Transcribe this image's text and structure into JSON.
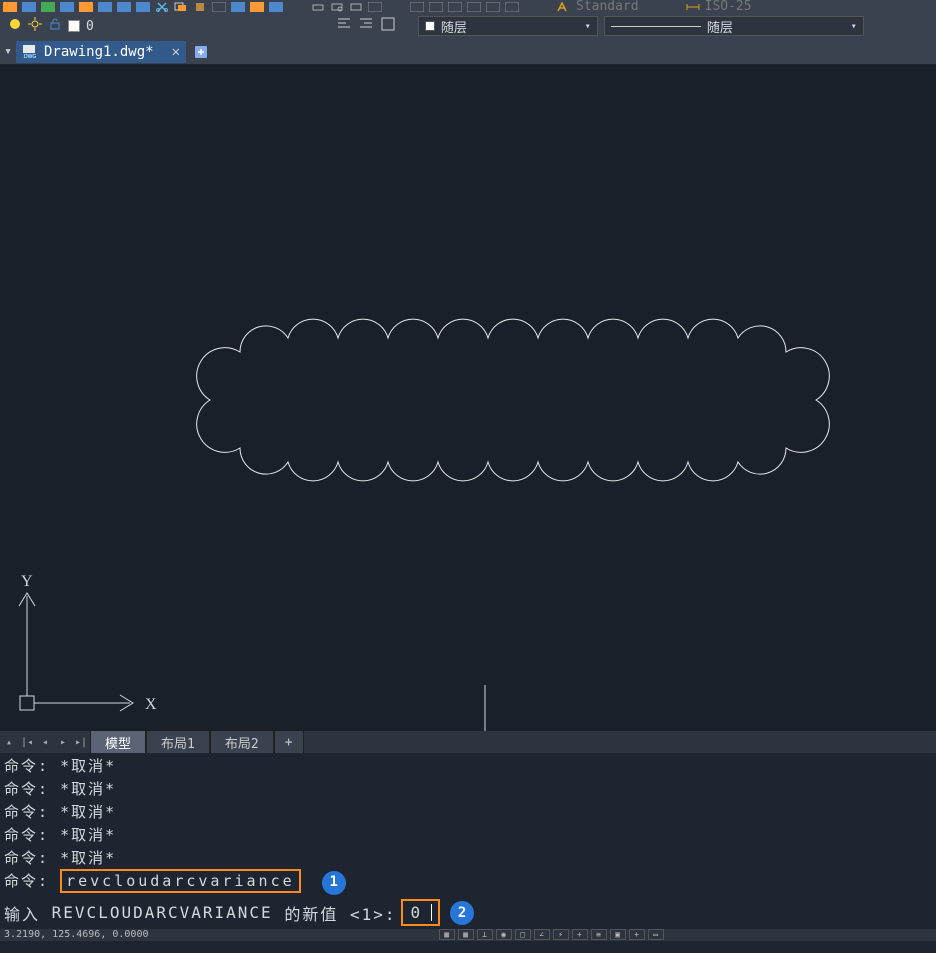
{
  "top_style_dropdown_1": "Standard",
  "top_style_dropdown_2": "ISO-25",
  "layer_current": "0",
  "bylayer_label_1": "随层",
  "bylayer_label_2": "随层",
  "file_tab": {
    "name": "Drawing1.dwg*"
  },
  "layout_tabs": {
    "model": "模型",
    "layout1": "布局1",
    "layout2": "布局2",
    "plus": "+"
  },
  "ucs": {
    "x": "X",
    "y": "Y"
  },
  "command_history": [
    {
      "prompt": "命令:",
      "text": "*取消*"
    },
    {
      "prompt": "命令:",
      "text": "*取消*"
    },
    {
      "prompt": "命令:",
      "text": "*取消*"
    },
    {
      "prompt": "命令:",
      "text": "*取消*"
    },
    {
      "prompt": "命令:",
      "text": "*取消*"
    }
  ],
  "command_current": {
    "prompt": "命令:",
    "command": "revcloudarcvariance",
    "callout": "1"
  },
  "command_input": {
    "prompt_prefix": "输入",
    "variable_name": "REVCLOUDARCVARIANCE",
    "prompt_suffix": "的新值 <1>:",
    "value": "0",
    "callout": "2"
  },
  "status_bar": {
    "coords": "3.2190, 125.4696, 0.0000"
  }
}
